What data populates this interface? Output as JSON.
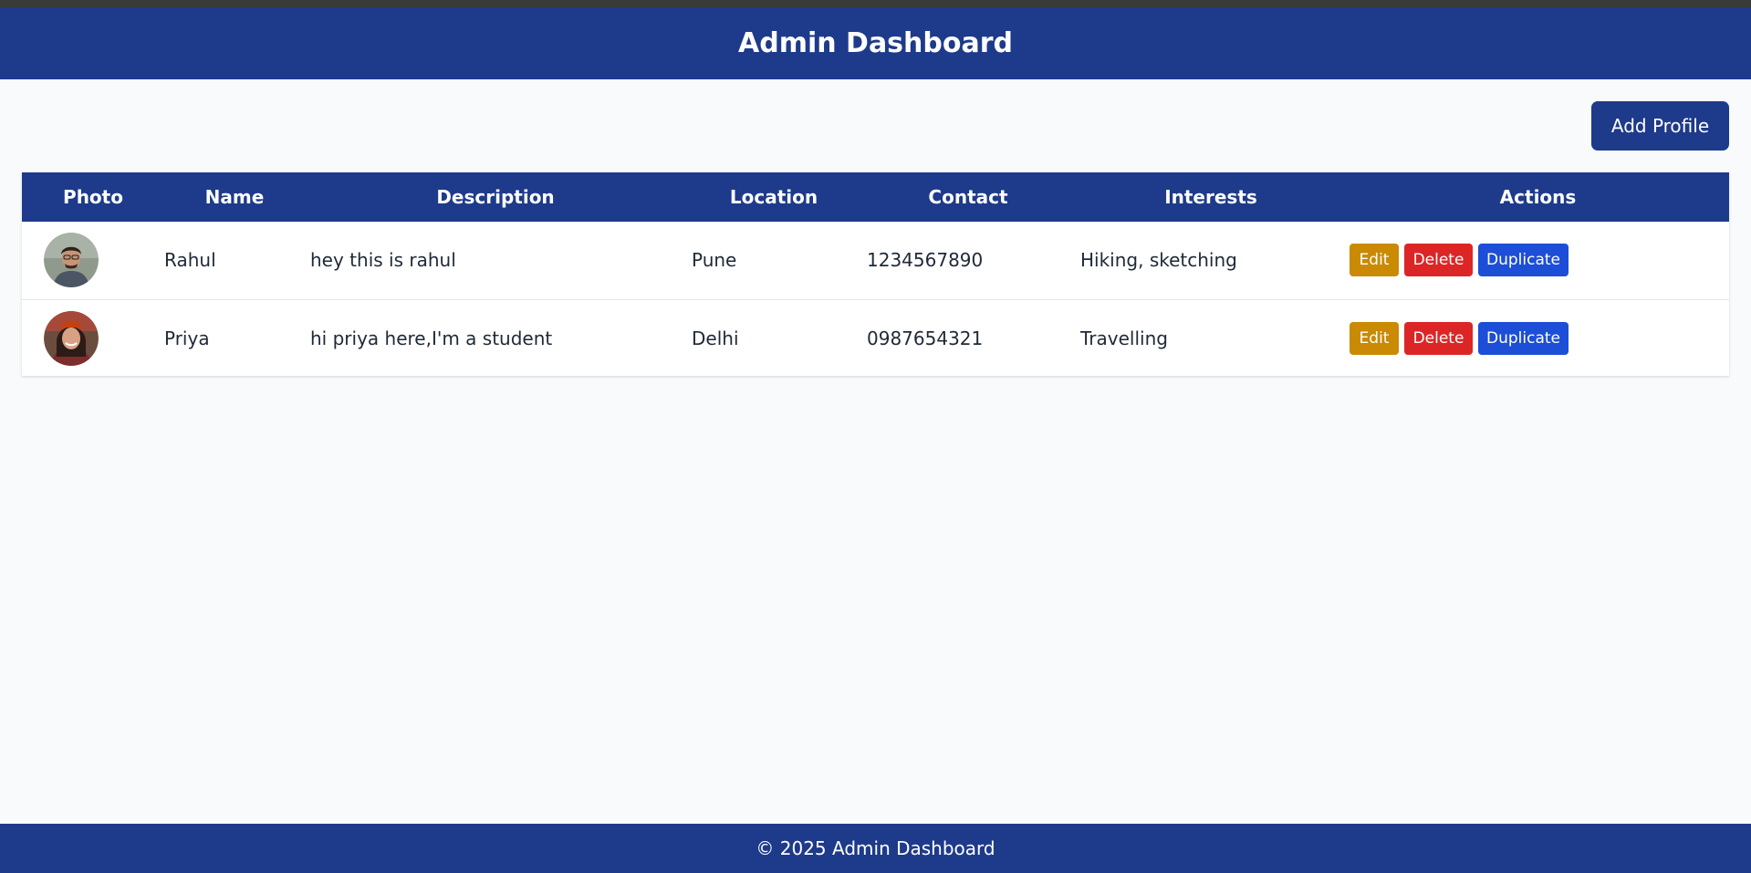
{
  "header": {
    "title": "Admin Dashboard"
  },
  "toolbar": {
    "add_profile_label": "Add Profile"
  },
  "table": {
    "columns": [
      "Photo",
      "Name",
      "Description",
      "Location",
      "Contact",
      "Interests",
      "Actions"
    ],
    "rows": [
      {
        "name": "Rahul",
        "description": "hey this is rahul",
        "location": "Pune",
        "contact": "1234567890",
        "interests": "Hiking, sketching",
        "actions": {
          "edit": "Edit",
          "delete": "Delete",
          "duplicate": "Duplicate"
        }
      },
      {
        "name": "Priya",
        "description": "hi priya here,I'm a student",
        "location": "Delhi",
        "contact": "0987654321",
        "interests": "Travelling",
        "actions": {
          "edit": "Edit",
          "delete": "Delete",
          "duplicate": "Duplicate"
        }
      }
    ]
  },
  "footer": {
    "text": "© 2025 Admin Dashboard"
  },
  "colors": {
    "primary": "#1e3a8a",
    "edit": "#ca8a04",
    "delete": "#dc2626",
    "duplicate": "#1d4ed8",
    "background": "#f8fafc"
  }
}
